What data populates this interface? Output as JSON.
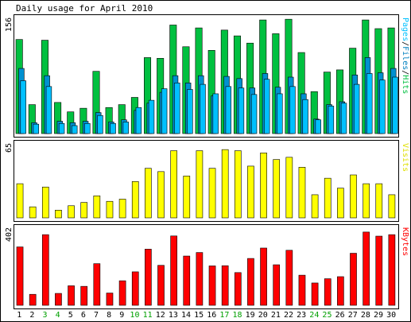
{
  "chart_data": {
    "type": "bar",
    "title": "Daily usage for April 2010",
    "categories": [
      "1",
      "2",
      "3",
      "4",
      "5",
      "6",
      "7",
      "8",
      "9",
      "10",
      "11",
      "12",
      "13",
      "14",
      "15",
      "16",
      "17",
      "18",
      "19",
      "20",
      "21",
      "22",
      "23",
      "24",
      "25",
      "26",
      "27",
      "28",
      "29",
      "30"
    ],
    "weekend_days": [
      "3",
      "4",
      "10",
      "11",
      "17",
      "18",
      "24",
      "25"
    ],
    "panels": [
      {
        "id": "hits",
        "ylabel_parts": [
          "Pages",
          "Files",
          "Hits"
        ],
        "ymax_label": "156",
        "ylim": [
          0,
          156
        ],
        "series": [
          {
            "name": "Hits",
            "color": "#00c040",
            "values": [
              130,
              40,
              129,
              43,
              30,
              35,
              86,
              36,
              40,
              50,
              105,
              104,
              150,
              120,
              146,
              115,
              143,
              135,
              125,
              157,
              138,
              158,
              112,
              58,
              85,
              88,
              118,
              157,
              145,
              146
            ]
          },
          {
            "name": "Files",
            "color": "#0090d0",
            "values": [
              90,
              15,
              80,
              17,
              15,
              17,
              29,
              16,
              19,
              32,
              42,
              57,
              80,
              70,
              80,
              52,
              79,
              76,
              63,
              83,
              64,
              78,
              55,
              20,
              40,
              44,
              81,
              105,
              84,
              90
            ]
          },
          {
            "name": "Pages",
            "color": "#00c0ff",
            "values": [
              73,
              13,
              65,
              14,
              11,
              14,
              25,
              14,
              16,
              36,
              46,
              62,
              70,
              61,
              68,
              55,
              65,
              63,
              54,
              75,
              55,
              65,
              47,
              19,
              38,
              42,
              68,
              83,
              74,
              78
            ]
          }
        ]
      },
      {
        "id": "visits",
        "ylabel_parts": [
          "Visits"
        ],
        "ymax_label": "65",
        "ylim": [
          0,
          65
        ],
        "series": [
          {
            "name": "Visits",
            "color": "#ffff00",
            "values": [
              31,
              10,
              28,
              7,
              11,
              14,
              20,
              15,
              17,
              33,
              45,
              42,
              61,
              38,
              61,
              45,
              62,
              61,
              47,
              59,
              53,
              55,
              46,
              21,
              36,
              27,
              39,
              31,
              31,
              21
            ]
          }
        ]
      },
      {
        "id": "kbytes",
        "ylabel_parts": [
          "KBytes"
        ],
        "ymax_label": "402",
        "ylim": [
          0,
          402
        ],
        "series": [
          {
            "name": "KBytes",
            "color": "#ff0000",
            "values": [
              314,
              59,
              380,
              64,
              105,
              102,
              224,
              66,
              132,
              180,
              302,
              215,
              373,
              265,
              284,
              212,
              213,
              176,
              252,
              308,
              218,
              296,
              162,
              120,
              143,
              154,
              280,
              394,
              372,
              380
            ]
          }
        ]
      }
    ],
    "colors": {
      "background": "#ffffff",
      "border": "#000000",
      "weekday_label": "#000000",
      "weekend_label": "#00a000",
      "pages_label": "#00c0ff",
      "files_label": "#0080c0",
      "hits_label": "#00c040",
      "visits_label": "#e0e000",
      "kbytes_label": "#ff0000",
      "separator": "#000000"
    }
  }
}
